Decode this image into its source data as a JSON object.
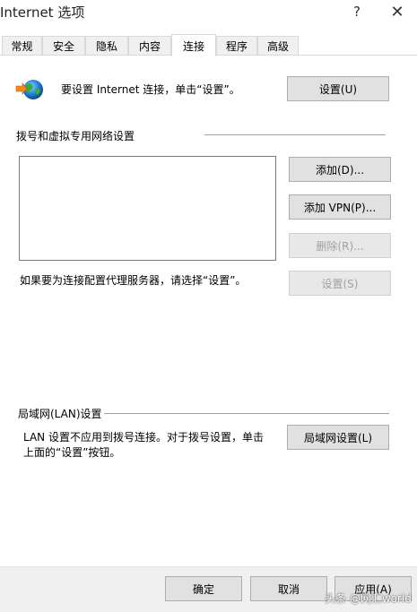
{
  "window": {
    "title": "Internet 选项",
    "help_glyph": "?",
    "close_glyph": "✕"
  },
  "tabs": [
    {
      "label": "常规"
    },
    {
      "label": "安全"
    },
    {
      "label": "隐私"
    },
    {
      "label": "内容"
    },
    {
      "label": "连接",
      "active": true
    },
    {
      "label": "程序"
    },
    {
      "label": "高级"
    }
  ],
  "setup": {
    "text": "要设置 Internet 连接，单击“设置”。",
    "button": "设置(U)"
  },
  "dialup": {
    "heading": "拨号和虚拟专用网络设置",
    "add_button": "添加(D)...",
    "add_vpn_button": "添加 VPN(P)...",
    "delete_button": "删除(R)...",
    "proxy_text": "如果要为连接配置代理服务器，请选择“设置”。",
    "settings_button": "设置(S)"
  },
  "lan": {
    "heading": "局域网(LAN)设置",
    "text_line1": "LAN 设置不应用到拨号连接。对于拨号设置，单击",
    "text_line2": "上面的“设置”按钮。",
    "button": "局域网设置(L)"
  },
  "footer": {
    "ok": "确定",
    "cancel": "取消",
    "apply": "应用(A)"
  },
  "watermark": "头条 @网汇world",
  "colors": {
    "button_bg": "#e1e1e1",
    "button_border": "#adadad",
    "disabled_text": "#a0a0a0",
    "footer_bg": "#f0f0f0"
  }
}
